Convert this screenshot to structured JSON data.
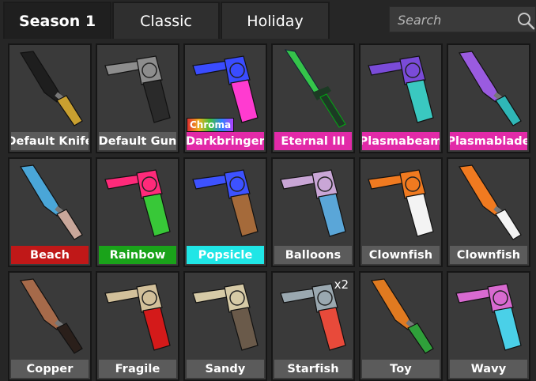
{
  "tabs": [
    {
      "label": "Season 1",
      "active": true
    },
    {
      "label": "Classic",
      "active": false
    },
    {
      "label": "Holiday",
      "active": false
    }
  ],
  "search": {
    "placeholder": "Search",
    "icon": "search-icon"
  },
  "items": [
    {
      "name": "Default Knife",
      "label_color": "#5b5b5b",
      "weapon": "knife",
      "colors": [
        "#1e1e1e",
        "#c9a030"
      ]
    },
    {
      "name": "Default Gun",
      "label_color": "#5b5b5b",
      "weapon": "gun",
      "colors": [
        "#8d8d8d",
        "#2a2a2a"
      ]
    },
    {
      "name": "Darkbringer",
      "label_color": "#e22aa8",
      "weapon": "gun-rainbow",
      "colors": [
        "#3a4cff",
        "#ff3bd0"
      ],
      "badge": "Chroma"
    },
    {
      "name": "Eternal III",
      "label_color": "#e22aa8",
      "weapon": "sword",
      "colors": [
        "#35c44a",
        "#1c3a24"
      ]
    },
    {
      "name": "Plasmabeam",
      "label_color": "#e22aa8",
      "weapon": "gun-plasma",
      "colors": [
        "#7a4bd8",
        "#3ac8c0"
      ]
    },
    {
      "name": "Plasmablade",
      "label_color": "#e22aa8",
      "weapon": "knife-plasma",
      "colors": [
        "#9a5be0",
        "#2fb7b7"
      ]
    },
    {
      "name": "Beach",
      "label_color": "#c01818",
      "weapon": "knife",
      "colors": [
        "#4aa6d8",
        "#c9a79a"
      ]
    },
    {
      "name": "Rainbow",
      "label_color": "#1aa31a",
      "weapon": "gun-rainbow",
      "colors": [
        "#ff2a7a",
        "#38c838"
      ]
    },
    {
      "name": "Popsicle",
      "label_color": "#20e6e6",
      "weapon": "gun",
      "colors": [
        "#3d52ff",
        "#a56a3a"
      ]
    },
    {
      "name": "Balloons",
      "label_color": "#5b5b5b",
      "weapon": "gun",
      "colors": [
        "#c9a6d6",
        "#5aa6d8"
      ]
    },
    {
      "name": "Clownfish",
      "label_color": "#5b5b5b",
      "weapon": "gun",
      "colors": [
        "#f07a20",
        "#f3f3f3"
      ]
    },
    {
      "name": "Clownfish",
      "label_color": "#5b5b5b",
      "weapon": "knife",
      "colors": [
        "#f07a20",
        "#f3f3f3"
      ]
    },
    {
      "name": "Copper",
      "label_color": "#5b5b5b",
      "weapon": "knife",
      "colors": [
        "#a66a4a",
        "#2a1f1a"
      ]
    },
    {
      "name": "Fragile",
      "label_color": "#5b5b5b",
      "weapon": "gun",
      "colors": [
        "#d2c09a",
        "#d41a1a"
      ]
    },
    {
      "name": "Sandy",
      "label_color": "#5b5b5b",
      "weapon": "gun",
      "colors": [
        "#d6caa6",
        "#6a5a4a"
      ]
    },
    {
      "name": "Starfish",
      "label_color": "#5b5b5b",
      "weapon": "gun",
      "colors": [
        "#9aa8b0",
        "#e84a3a"
      ],
      "count": "x2"
    },
    {
      "name": "Toy",
      "label_color": "#5b5b5b",
      "weapon": "knife",
      "colors": [
        "#e07a20",
        "#2fa03a"
      ]
    },
    {
      "name": "Wavy",
      "label_color": "#5b5b5b",
      "weapon": "gun",
      "colors": [
        "#d86ad0",
        "#4ad0e8"
      ]
    }
  ]
}
